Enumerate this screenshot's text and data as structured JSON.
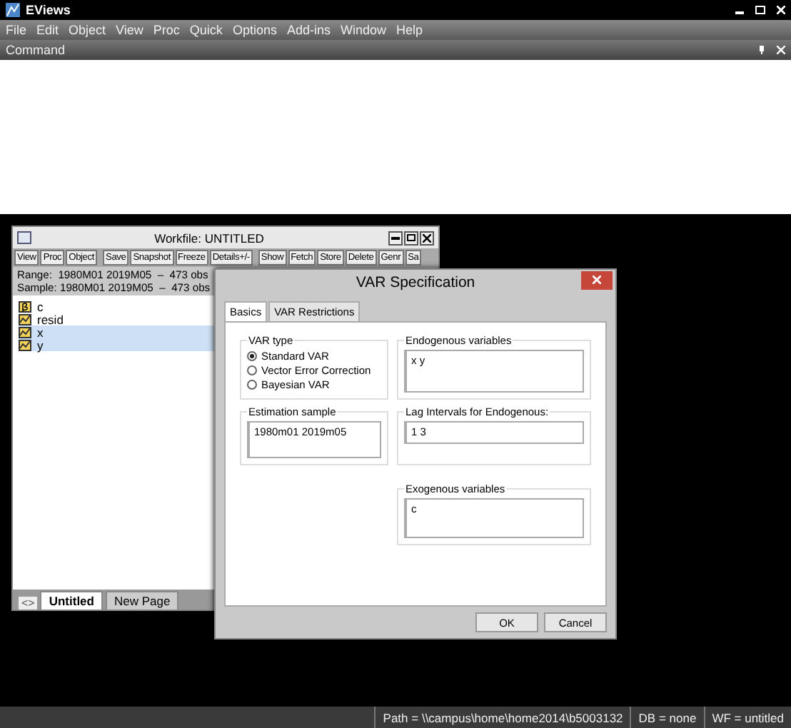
{
  "app": {
    "title": "EViews"
  },
  "menu": [
    "File",
    "Edit",
    "Object",
    "View",
    "Proc",
    "Quick",
    "Options",
    "Add-ins",
    "Window",
    "Help"
  ],
  "command_pane": {
    "title": "Command"
  },
  "workfile": {
    "title": "Workfile: UNTITLED",
    "toolbar": [
      "View",
      "Proc",
      "Object",
      "Save",
      "Snapshot",
      "Freeze",
      "Details+/-",
      "Show",
      "Fetch",
      "Store",
      "Delete",
      "Genr",
      "Sa"
    ],
    "range": "Range:  1980M01 2019M05  –  473 obs",
    "sample": "Sample: 1980M01 2019M05  –  473 obs",
    "objects": [
      {
        "name": "c",
        "kind": "coef",
        "selected": false
      },
      {
        "name": "resid",
        "kind": "series",
        "selected": false
      },
      {
        "name": "x",
        "kind": "series",
        "selected": true
      },
      {
        "name": "y",
        "kind": "series",
        "selected": true
      }
    ],
    "nav": "<>",
    "pages": [
      {
        "label": "Untitled",
        "selected": true
      },
      {
        "label": "New Page",
        "selected": false
      }
    ]
  },
  "dialog": {
    "title": "VAR Specification",
    "tabs": [
      {
        "label": "Basics",
        "selected": true
      },
      {
        "label": "VAR Restrictions",
        "selected": false
      }
    ],
    "var_type": {
      "label": "VAR type",
      "options": [
        {
          "label": "Standard VAR",
          "selected": true
        },
        {
          "label": "Vector Error Correction",
          "selected": false
        },
        {
          "label": "Bayesian VAR",
          "selected": false
        }
      ]
    },
    "endogenous": {
      "label": "Endogenous variables",
      "value": "x y"
    },
    "estimation_sample": {
      "label": "Estimation sample",
      "value": "1980m01 2019m05"
    },
    "lag_intervals": {
      "label": "Lag Intervals for Endogenous:",
      "value": "1 3"
    },
    "exogenous": {
      "label": "Exogenous variables",
      "value": "c"
    },
    "buttons": [
      "OK",
      "Cancel"
    ]
  },
  "status_bar": [
    "Path = \\\\campus\\home\\home2014\\b5003132",
    "DB = none",
    "WF = untitled"
  ]
}
